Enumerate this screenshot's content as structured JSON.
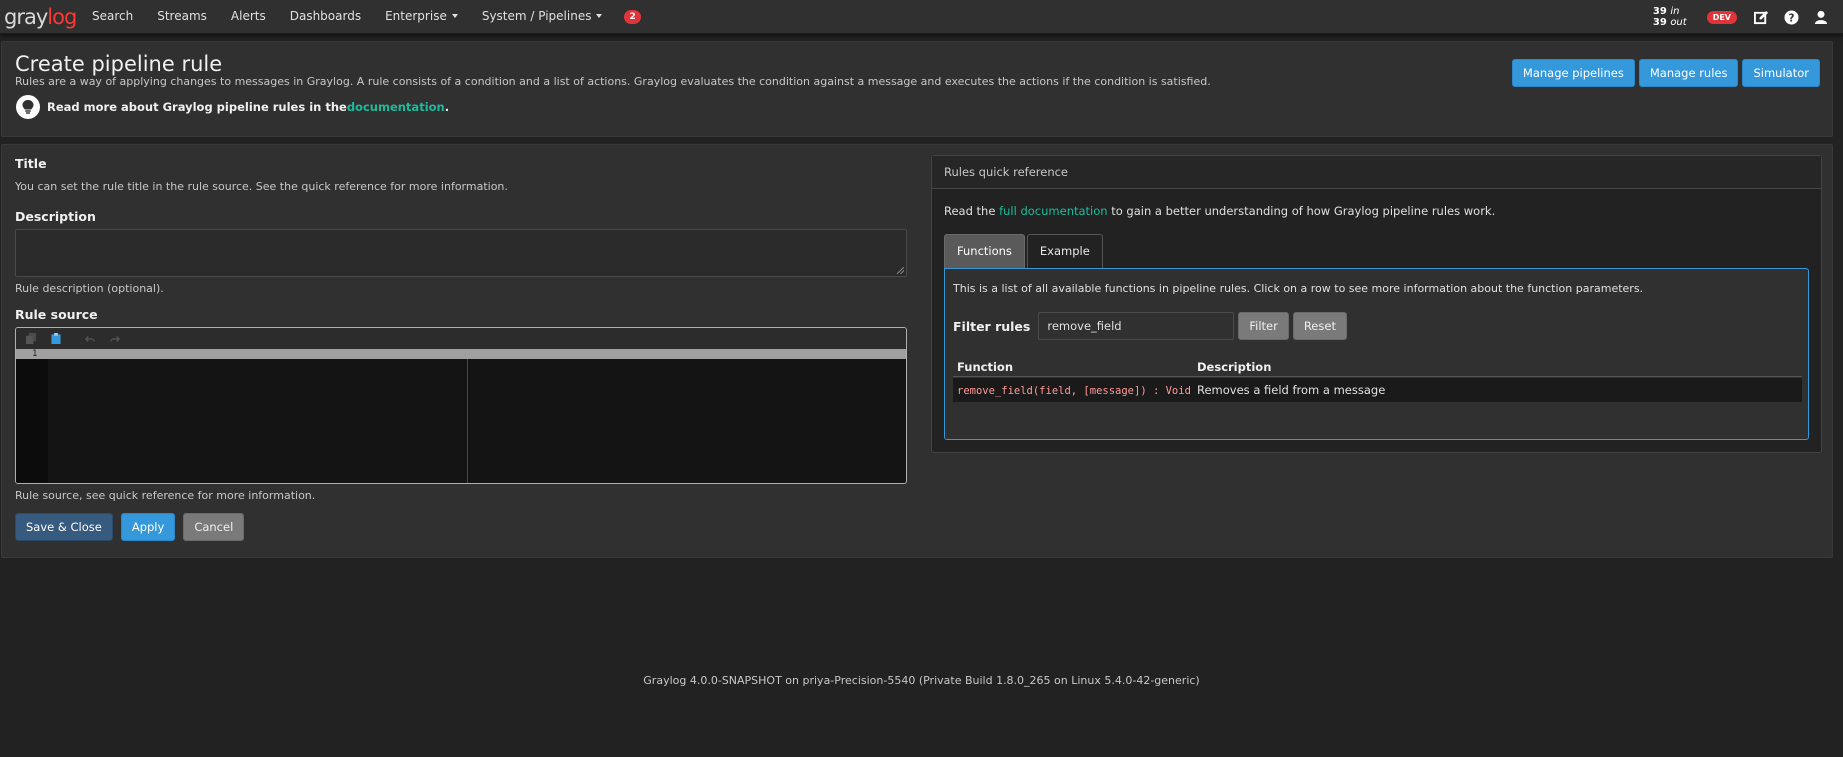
{
  "navbar": {
    "brand_part1": "gray",
    "brand_part2": "log",
    "items": [
      {
        "label": "Search"
      },
      {
        "label": "Streams"
      },
      {
        "label": "Alerts"
      },
      {
        "label": "Dashboards"
      },
      {
        "label": "Enterprise"
      },
      {
        "label": "System / Pipelines"
      }
    ],
    "notification_count": "2",
    "throughput_in": "39",
    "throughput_in_label": "in",
    "throughput_out": "39",
    "throughput_out_label": "out",
    "env_badge": "DEV",
    "icons": [
      "edit-icon",
      "help-icon",
      "user-icon"
    ]
  },
  "header": {
    "title": "Create pipeline rule",
    "description": "Rules are a way of applying changes to messages in Graylog. A rule consists of a condition and a list of actions. Graylog evaluates the condition against a message and executes the actions if the condition is satisfied.",
    "doc_prefix": "Read more about Graylog pipeline rules in the ",
    "doc_link": "documentation",
    "doc_suffix": ".",
    "buttons": {
      "manage_pipelines": "Manage pipelines",
      "manage_rules": "Manage rules",
      "simulator": "Simulator"
    }
  },
  "form": {
    "title_label": "Title",
    "title_help": "You can set the rule title in the rule source. See the quick reference for more information.",
    "description_label": "Description",
    "description_value": "",
    "description_help": "Rule description (optional).",
    "source_label": "Rule source",
    "source_line_number": "1",
    "source_help": "Rule source, see quick reference for more information.",
    "save_close": "Save & Close",
    "apply": "Apply",
    "cancel": "Cancel"
  },
  "quick_reference": {
    "heading": "Rules quick reference",
    "read_prefix": "Read the ",
    "read_link": "full documentation",
    "read_suffix": " to gain a better understanding of how Graylog pipeline rules work.",
    "tabs": [
      {
        "label": "Functions",
        "active": true
      },
      {
        "label": "Example",
        "active": false
      }
    ],
    "functions_desc": "This is a list of all available functions in pipeline rules. Click on a row to see more information about the function parameters.",
    "filter_label": "Filter rules",
    "filter_value": "remove_field",
    "filter_button": "Filter",
    "reset_button": "Reset",
    "table": {
      "headers": [
        "Function",
        "Description"
      ],
      "rows": [
        {
          "signature": "remove_field(field, [message]) : Void",
          "description": "Removes a field from a message"
        }
      ]
    }
  },
  "footer": {
    "text": "Graylog 4.0.0-SNAPSHOT on priya-Precision-5540 (Private Build 1.8.0_265 on Linux 5.4.0-42-generic)"
  },
  "colors": {
    "accent": "#3498db",
    "link": "#1abc9c",
    "danger": "#e0343a",
    "primary": "#375a7f"
  }
}
